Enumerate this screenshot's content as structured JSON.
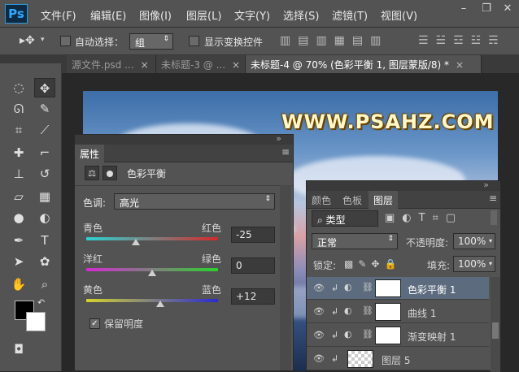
{
  "app": {
    "logo": "Ps",
    "menu": [
      "文件(F)",
      "编辑(E)",
      "图像(I)",
      "图层(L)",
      "文字(Y)",
      "选择(S)",
      "滤镜(T)",
      "视图(V)"
    ],
    "window_controls": {
      "minimize": "–",
      "restore": "❐",
      "close": "✕"
    }
  },
  "options_bar": {
    "auto_select_label": "自动选择：",
    "auto_select_value": "组",
    "show_transform_label": "显示变换控件"
  },
  "tabs": [
    {
      "label": "源文件.psd ...",
      "close": "×"
    },
    {
      "label": "未标题-3 @ ...",
      "close": "×"
    },
    {
      "label": "未标题-4 @ 70% (色彩平衡 1, 图层蒙版/8) *",
      "close": "×"
    }
  ],
  "canvas": {
    "watermark": "WWW.PSAHZ.COM"
  },
  "properties": {
    "tab": "属性",
    "title": "色彩平衡",
    "tone_label": "色调:",
    "tone_value": "高光",
    "sliders": [
      {
        "left": "青色",
        "right": "红色",
        "value": "-25",
        "fraction": 0.375
      },
      {
        "left": "洋红",
        "right": "绿色",
        "value": "0",
        "fraction": 0.5
      },
      {
        "left": "黄色",
        "right": "蓝色",
        "value": "+12",
        "fraction": 0.56
      }
    ],
    "preserve_luminosity": "保留明度"
  },
  "layers_panel": {
    "tabs": [
      "颜色",
      "色板",
      "图层"
    ],
    "filter_label": "类型",
    "blend_mode": "正常",
    "opacity_label": "不透明度:",
    "opacity_value": "100%",
    "lock_label": "锁定:",
    "fill_label": "填充:",
    "fill_value": "100%",
    "layers": [
      {
        "name": "色彩平衡 1",
        "active": true
      },
      {
        "name": "曲线 1",
        "active": false
      },
      {
        "name": "渐变映射 1",
        "active": false
      },
      {
        "name": "图层 5",
        "active": false
      }
    ]
  },
  "colors": {
    "accent": "#31a8ff",
    "panel": "#535353",
    "watermark": "#fff7c8"
  }
}
